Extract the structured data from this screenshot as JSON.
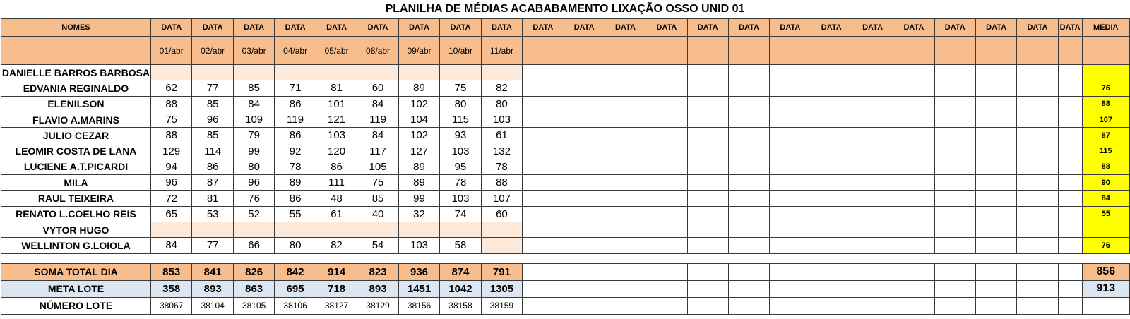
{
  "title": "PLANILHA DE MÉDIAS ACABABAMENTO LIXAÇÃO OSSO UNID 01",
  "header": {
    "names_label": "NOMES",
    "data_label": "DATA",
    "media_label": "MÉDIA",
    "dates": [
      "01/abr",
      "02/abr",
      "03/abr",
      "04/abr",
      "05/abr",
      "08/abr",
      "09/abr",
      "10/abr",
      "11/abr"
    ]
  },
  "rows": [
    {
      "name": "DANIELLE BARROS BARBOSA",
      "values": [
        "",
        "",
        "",
        "",
        "",
        "",
        "",
        "",
        ""
      ],
      "avg": ""
    },
    {
      "name": "EDVANIA REGINALDO",
      "values": [
        "62",
        "77",
        "85",
        "71",
        "81",
        "60",
        "89",
        "75",
        "82"
      ],
      "avg": "76"
    },
    {
      "name": "ELENILSON",
      "values": [
        "88",
        "85",
        "84",
        "86",
        "101",
        "84",
        "102",
        "80",
        "80"
      ],
      "avg": "88"
    },
    {
      "name": "FLAVIO A.MARINS",
      "values": [
        "75",
        "96",
        "109",
        "119",
        "121",
        "119",
        "104",
        "115",
        "103"
      ],
      "avg": "107"
    },
    {
      "name": "JULIO CEZAR",
      "values": [
        "88",
        "85",
        "79",
        "86",
        "103",
        "84",
        "102",
        "93",
        "61"
      ],
      "avg": "87"
    },
    {
      "name": "LEOMIR COSTA DE LANA",
      "values": [
        "129",
        "114",
        "99",
        "92",
        "120",
        "117",
        "127",
        "103",
        "132"
      ],
      "avg": "115"
    },
    {
      "name": "LUCIENE A.T.PICARDI",
      "values": [
        "94",
        "86",
        "80",
        "78",
        "86",
        "105",
        "89",
        "95",
        "78"
      ],
      "avg": "88"
    },
    {
      "name": "MILA",
      "values": [
        "96",
        "87",
        "96",
        "89",
        "111",
        "75",
        "89",
        "78",
        "88"
      ],
      "avg": "90"
    },
    {
      "name": "RAUL TEIXEIRA",
      "values": [
        "72",
        "81",
        "76",
        "86",
        "48",
        "85",
        "99",
        "103",
        "107"
      ],
      "avg": "84"
    },
    {
      "name": "RENATO L.COELHO REIS",
      "values": [
        "65",
        "53",
        "52",
        "55",
        "61",
        "40",
        "32",
        "74",
        "60"
      ],
      "avg": "55"
    },
    {
      "name": "VYTOR HUGO",
      "values": [
        "",
        "",
        "",
        "",
        "",
        "",
        "",
        "",
        ""
      ],
      "avg": ""
    },
    {
      "name": "WELLINTON G.LOIOLA",
      "values": [
        "84",
        "77",
        "66",
        "80",
        "82",
        "54",
        "103",
        "58",
        ""
      ],
      "avg": "76"
    }
  ],
  "soma": {
    "label": "SOMA TOTAL DIA",
    "values": [
      "853",
      "841",
      "826",
      "842",
      "914",
      "823",
      "936",
      "874",
      "791"
    ],
    "total": "856"
  },
  "meta": {
    "label": "META LOTE",
    "values": [
      "358",
      "893",
      "863",
      "695",
      "718",
      "893",
      "1451",
      "1042",
      "1305"
    ],
    "total": "913"
  },
  "lote": {
    "label": "NÚMERO LOTE",
    "values": [
      "38067",
      "38104",
      "38105",
      "38106",
      "38127",
      "38129",
      "38156",
      "38158",
      "38159"
    ]
  },
  "colors": {
    "header_bg": "#f8bd8c",
    "empty_cell_bg": "#fde9da",
    "avg_bg": "#ffff00",
    "meta_bg": "#dce6f1"
  }
}
